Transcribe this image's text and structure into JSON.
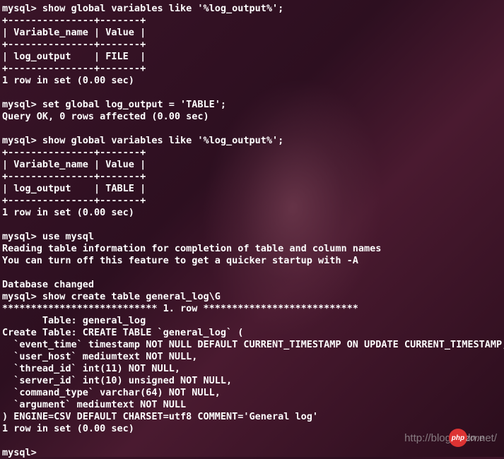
{
  "terminal": {
    "lines": [
      "mysql> show global variables like '%log_output%';",
      "+---------------+-------+",
      "| Variable_name | Value |",
      "+---------------+-------+",
      "| log_output    | FILE  |",
      "+---------------+-------+",
      "1 row in set (0.00 sec)",
      "",
      "mysql> set global log_output = 'TABLE';",
      "Query OK, 0 rows affected (0.00 sec)",
      "",
      "mysql> show global variables like '%log_output%';",
      "+---------------+-------+",
      "| Variable_name | Value |",
      "+---------------+-------+",
      "| log_output    | TABLE |",
      "+---------------+-------+",
      "1 row in set (0.00 sec)",
      "",
      "mysql> use mysql",
      "Reading table information for completion of table and column names",
      "You can turn off this feature to get a quicker startup with -A",
      "",
      "Database changed",
      "mysql> show create table general_log\\G",
      "*************************** 1. row ***************************",
      "       Table: general_log",
      "Create Table: CREATE TABLE `general_log` (",
      "  `event_time` timestamp NOT NULL DEFAULT CURRENT_TIMESTAMP ON UPDATE CURRENT_TIMESTAMP,",
      "  `user_host` mediumtext NOT NULL,",
      "  `thread_id` int(11) NOT NULL,",
      "  `server_id` int(10) unsigned NOT NULL,",
      "  `command_type` varchar(64) NOT NULL,",
      "  `argument` mediumtext NOT NULL",
      ") ENGINE=CSV DEFAULT CHARSET=utf8 COMMENT='General log'",
      "1 row in set (0.00 sec)",
      "",
      "mysql> "
    ]
  },
  "watermark": {
    "text": "http://blog.csdn.net/"
  },
  "logo": {
    "circle": "php",
    "suffix": "zone"
  }
}
